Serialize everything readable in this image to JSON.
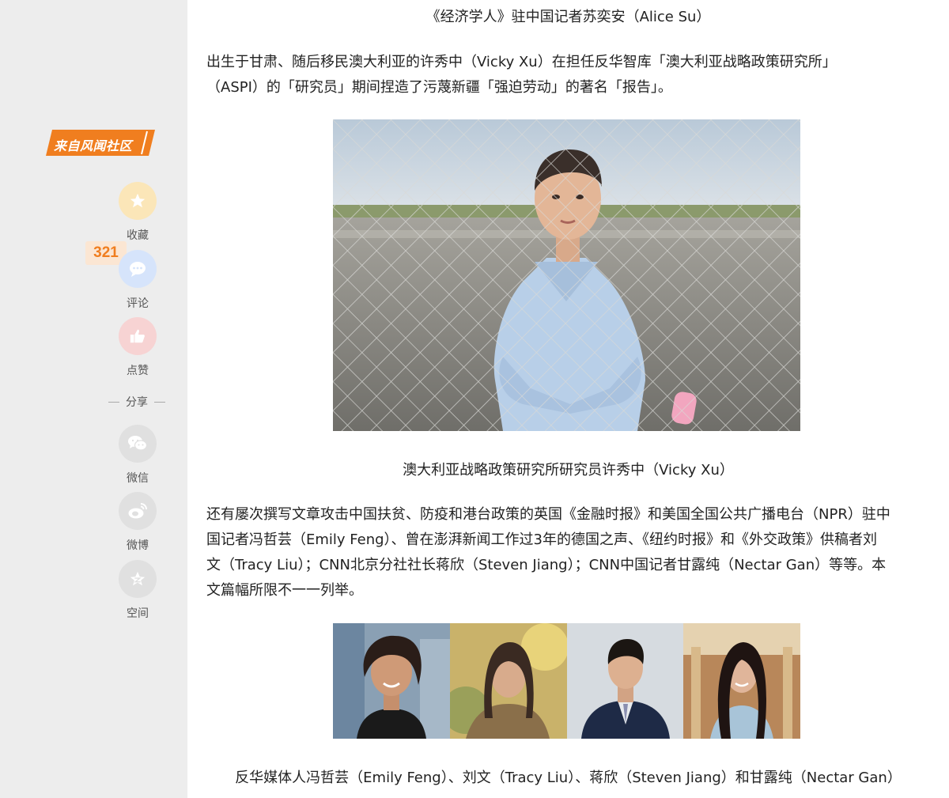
{
  "sidebar": {
    "source_tag": "来自风闻社区",
    "actions": [
      {
        "label": "收藏",
        "icon": "star-icon"
      },
      {
        "label": "评论",
        "icon": "comment-icon"
      },
      {
        "label": "点赞",
        "icon": "thumbs-up-icon"
      }
    ],
    "comment_count": "321",
    "share_title": "分享",
    "share_items": [
      {
        "label": "微信",
        "icon": "wechat-icon"
      },
      {
        "label": "微博",
        "icon": "weibo-icon"
      },
      {
        "label": "空间",
        "icon": "qzone-icon"
      }
    ],
    "colors": {
      "accent": "#f07e1f",
      "star_bg": "#fbe6b8",
      "comment_bg": "#d6e4fb",
      "like_bg": "#f7d3d3",
      "share_bg": "#e0e0e0"
    }
  },
  "article": {
    "caption_top": "《经济学人》驻中国记者苏奕安（Alice Su）",
    "paragraph_1_line_1": "出生于甘肃、随后移民澳大利亚的许秀中（Vicky Xu）在担任反华智库「澳大利亚战略政策研究所」",
    "paragraph_1_line_2": "（ASPI）的「研究员」期间捏造了污蔑新疆「强迫劳动」的著名「报告」。",
    "caption_photo": "澳大利亚战略政策研究所研究员许秀中（Vicky Xu）",
    "paragraph_2_lines": [
      "还有屡次撰写文章攻击中国扶贫、防疫和港台政策的英国《金融时报》和美国全国公共广播电台（NPR）驻中",
      "国记者冯哲芸（Emily Feng）、曾在澎湃新闻工作过3年的德国之声、《纽约时报》和《外交政策》供稿者刘",
      "文（Tracy Liu）；CNN北京分社社长蒋欣（Steven Jiang）；CNN中国记者甘露纯（Nectar Gan）等等。本",
      "文篇幅所限不一一列举。"
    ],
    "caption_bottom": "反华媒体人冯哲芸（Emily Feng）、刘文（Tracy Liu）、蒋欣（Steven Jiang）和甘露纯（Nectar Gan）"
  }
}
